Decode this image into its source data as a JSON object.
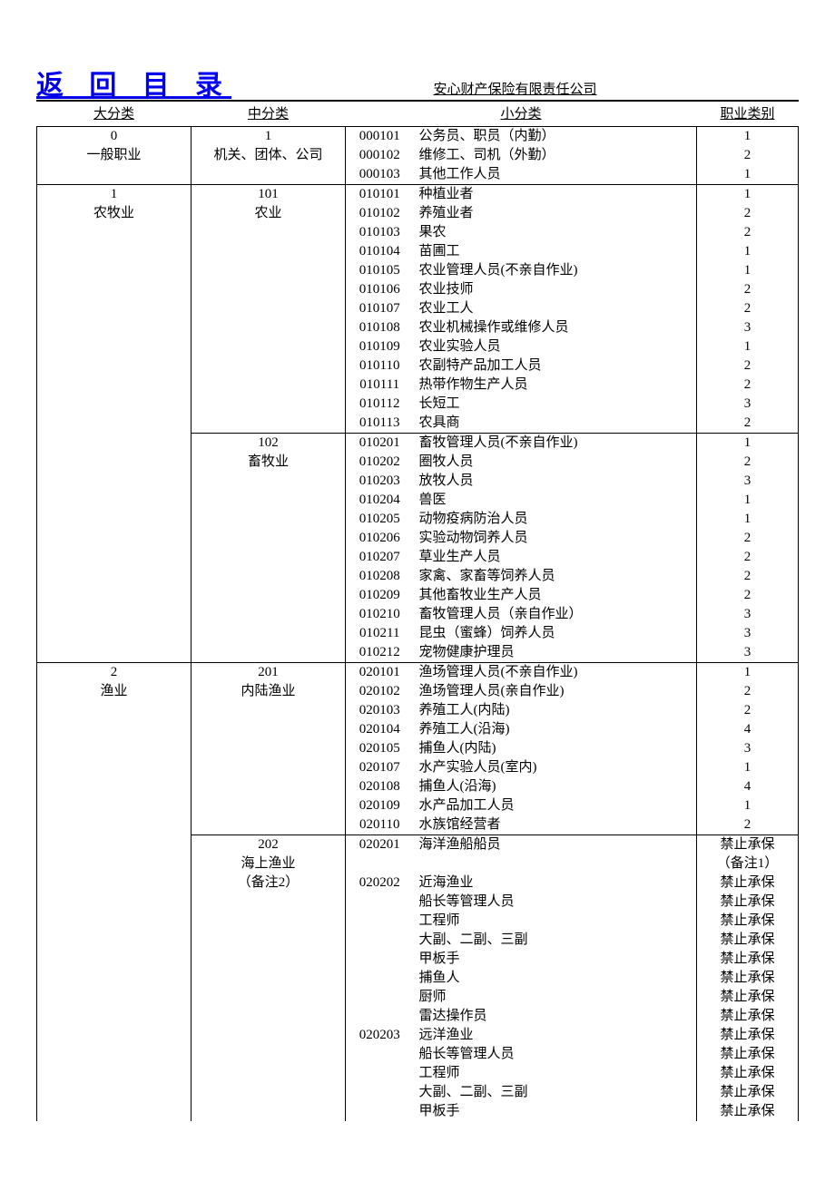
{
  "header": {
    "back_link": "返  回  目  录",
    "company": "安心财产保险有限责任公司"
  },
  "columns": {
    "major": "大分类",
    "middle": "中分类",
    "sub": "小分类",
    "cat": "职业类别"
  },
  "groups": [
    {
      "major_code": "0",
      "major_name": "一般职业",
      "middles": [
        {
          "mid_code": "1",
          "mid_name": "机关、团体、公司",
          "mid_notes": [],
          "rows": [
            {
              "code": "000101",
              "name": "公务员、职员（内勤）",
              "cat": "1"
            },
            {
              "code": "000102",
              "name": "维修工、司机（外勤）",
              "cat": "2"
            },
            {
              "code": "000103",
              "name": "其他工作人员",
              "cat": "1"
            }
          ]
        }
      ]
    },
    {
      "major_code": "1",
      "major_name": "农牧业",
      "middles": [
        {
          "mid_code": "101",
          "mid_name": "农业",
          "mid_notes": [],
          "rows": [
            {
              "code": "010101",
              "name": "种植业者",
              "cat": "1"
            },
            {
              "code": "010102",
              "name": "养殖业者",
              "cat": "2"
            },
            {
              "code": "010103",
              "name": "果农",
              "cat": "2"
            },
            {
              "code": "010104",
              "name": "苗圃工",
              "cat": "1"
            },
            {
              "code": "010105",
              "name": "农业管理人员(不亲自作业)",
              "cat": "1"
            },
            {
              "code": "010106",
              "name": "农业技师",
              "cat": "2"
            },
            {
              "code": "010107",
              "name": "农业工人",
              "cat": "2"
            },
            {
              "code": "010108",
              "name": "农业机械操作或维修人员",
              "cat": "3"
            },
            {
              "code": "010109",
              "name": "农业实验人员",
              "cat": "1"
            },
            {
              "code": "010110",
              "name": "农副特产品加工人员",
              "cat": "2"
            },
            {
              "code": "010111",
              "name": "热带作物生产人员",
              "cat": "2"
            },
            {
              "code": "010112",
              "name": "长短工",
              "cat": "3"
            },
            {
              "code": "010113",
              "name": "农具商",
              "cat": "2"
            }
          ]
        },
        {
          "mid_code": "102",
          "mid_name": "畜牧业",
          "mid_notes": [],
          "rows": [
            {
              "code": "010201",
              "name": "畜牧管理人员(不亲自作业)",
              "cat": "1"
            },
            {
              "code": "010202",
              "name": "圈牧人员",
              "cat": "2"
            },
            {
              "code": "010203",
              "name": "放牧人员",
              "cat": "3"
            },
            {
              "code": "010204",
              "name": "兽医",
              "cat": "1"
            },
            {
              "code": "010205",
              "name": "动物疫病防治人员",
              "cat": "1"
            },
            {
              "code": "010206",
              "name": "实验动物饲养人员",
              "cat": "2"
            },
            {
              "code": "010207",
              "name": "草业生产人员",
              "cat": "2"
            },
            {
              "code": "010208",
              "name": "家禽、家畜等饲养人员",
              "cat": "2"
            },
            {
              "code": "010209",
              "name": "其他畜牧业生产人员",
              "cat": "2"
            },
            {
              "code": "010210",
              "name": "畜牧管理人员（亲自作业）",
              "cat": "3"
            },
            {
              "code": "010211",
              "name": "昆虫（蜜蜂）饲养人员",
              "cat": "3"
            },
            {
              "code": "010212",
              "name": "宠物健康护理员",
              "cat": "3"
            }
          ]
        }
      ]
    },
    {
      "major_code": "2",
      "major_name": "渔业",
      "middles": [
        {
          "mid_code": "201",
          "mid_name": "内陆渔业",
          "mid_notes": [],
          "rows": [
            {
              "code": "020101",
              "name": "渔场管理人员(不亲自作业)",
              "cat": "1"
            },
            {
              "code": "020102",
              "name": "渔场管理人员(亲自作业)",
              "cat": "2"
            },
            {
              "code": "020103",
              "name": "养殖工人(内陆)",
              "cat": "2"
            },
            {
              "code": "020104",
              "name": "养殖工人(沿海)",
              "cat": "4"
            },
            {
              "code": "020105",
              "name": "捕鱼人(内陆)",
              "cat": "3"
            },
            {
              "code": "020107",
              "name": "水产实验人员(室内)",
              "cat": "1"
            },
            {
              "code": "020108",
              "name": "捕鱼人(沿海)",
              "cat": "4"
            },
            {
              "code": "020109",
              "name": "水产品加工人员",
              "cat": "1"
            },
            {
              "code": "020110",
              "name": "水族馆经营者",
              "cat": "2"
            }
          ]
        },
        {
          "mid_code": "202",
          "mid_name": "海上渔业",
          "mid_notes": [
            "（备注2）"
          ],
          "rows": [
            {
              "code": "020201",
              "name": "海洋渔船船员",
              "cat": "禁止承保"
            },
            {
              "code": "",
              "name": "",
              "cat": "（备注1）"
            },
            {
              "code": "020202",
              "name": "近海渔业",
              "cat": "禁止承保"
            },
            {
              "code": "",
              "name": "船长等管理人员",
              "cat": "禁止承保"
            },
            {
              "code": "",
              "name": "工程师",
              "cat": "禁止承保"
            },
            {
              "code": "",
              "name": "大副、二副、三副",
              "cat": "禁止承保"
            },
            {
              "code": "",
              "name": "甲板手",
              "cat": "禁止承保"
            },
            {
              "code": "",
              "name": "捕鱼人",
              "cat": "禁止承保"
            },
            {
              "code": "",
              "name": "厨师",
              "cat": "禁止承保"
            },
            {
              "code": "",
              "name": "雷达操作员",
              "cat": "禁止承保"
            },
            {
              "code": "020203",
              "name": "远洋渔业",
              "cat": "禁止承保"
            },
            {
              "code": "",
              "name": "船长等管理人员",
              "cat": "禁止承保"
            },
            {
              "code": "",
              "name": "工程师",
              "cat": "禁止承保"
            },
            {
              "code": "",
              "name": "大副、二副、三副",
              "cat": "禁止承保"
            },
            {
              "code": "",
              "name": "甲板手",
              "cat": "禁止承保"
            }
          ]
        }
      ]
    }
  ]
}
